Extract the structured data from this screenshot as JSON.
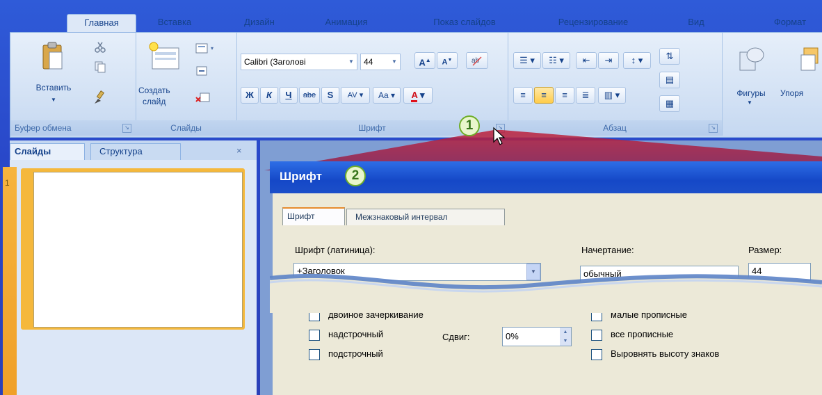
{
  "ribbon": {
    "tabs": [
      "Главная",
      "Вставка",
      "Дизайн",
      "Анимация",
      "Показ слайдов",
      "Рецензирование",
      "Вид",
      "Формат"
    ],
    "active_tab": "Главная",
    "groups": {
      "clipboard": {
        "label": "Буфер обмена",
        "paste_label": "Вставить"
      },
      "slides": {
        "label": "Слайды",
        "new_slide_label_1": "Создать",
        "new_slide_label_2": "слайд"
      },
      "font": {
        "label": "Шрифт",
        "font_name": "Calibri (Заголові",
        "font_size": "44"
      },
      "paragraph": {
        "label": "Абзац"
      },
      "drawing": {
        "shapes_label": "Фигуры",
        "arrange_label": "Упоря"
      }
    }
  },
  "format_buttons": {
    "bold": "Ж",
    "italic": "К",
    "underline": "Ч",
    "strike": "abe",
    "shadow": "S",
    "spacing": "AV",
    "case": "Aa",
    "color": "A"
  },
  "callouts": {
    "one": "1",
    "two": "2"
  },
  "slide_pane": {
    "tabs": [
      "Слайды",
      "Структура"
    ],
    "close": "×",
    "slide_number": "1"
  },
  "dialog": {
    "title": "Шрифт",
    "tabs": [
      "Шрифт",
      "Межзнаковый интервал"
    ],
    "font_label": "Шрифт (латиница):",
    "font_value": "+Заголовок",
    "style_label": "Начертание:",
    "style_value": "обычный",
    "size_label": "Размер:",
    "size_value": "44",
    "effects_left": [
      "двойное зачеркивание",
      "надстрочный",
      "подстрочный"
    ],
    "offset_label": "Сдвиг:",
    "offset_value": "0%",
    "effects_right": [
      "малые прописные",
      "все прописные",
      "Выровнять высоту знаков"
    ]
  },
  "colors": {
    "accent": "#2a48c8",
    "callout_green": "#6fae2a",
    "slide_orange": "#f5b83c"
  }
}
